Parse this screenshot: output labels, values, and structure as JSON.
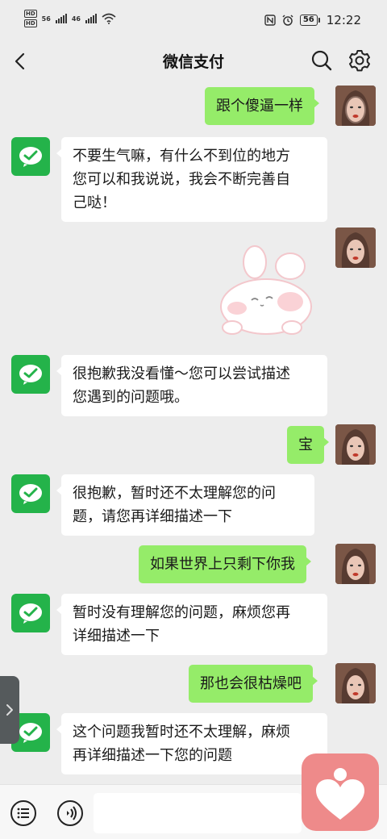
{
  "status_bar": {
    "hd_label": "HD",
    "net_type": "56",
    "net_type_2": "46",
    "battery": "56",
    "time": "12:22"
  },
  "header": {
    "title": "微信支付",
    "icons": [
      "back-arrow",
      "search",
      "settings-gear"
    ]
  },
  "messages": [
    {
      "from": "user",
      "type": "text",
      "text": "跟个傻逼一样"
    },
    {
      "from": "bot",
      "type": "text",
      "lines": [
        "不要生气嘛，有什么不到位的地方",
        "您可以和我说说，我会不断完善自",
        "己哒！"
      ]
    },
    {
      "from": "user",
      "type": "sticker",
      "sticker": "bunny-sticker"
    },
    {
      "from": "bot",
      "type": "text",
      "lines": [
        "很抱歉我没看懂～您可以尝试描述",
        "您遇到的问题哦。"
      ]
    },
    {
      "from": "user",
      "type": "text",
      "text": "宝"
    },
    {
      "from": "bot",
      "type": "text",
      "lines": [
        "很抱歉，暂时还不太理解您的问",
        "题，请您再详细描述一下"
      ]
    },
    {
      "from": "user",
      "type": "text",
      "text": "如果世界上只剩下你我"
    },
    {
      "from": "bot",
      "type": "text",
      "lines": [
        "暂时没有理解您的问题，麻烦您再",
        "详细描述一下"
      ]
    },
    {
      "from": "user",
      "type": "text",
      "text": "那也会很枯燥吧"
    },
    {
      "from": "bot",
      "type": "text",
      "lines": [
        "这个问题我暂时还不太理解，麻烦",
        "再详细描述一下您的问题"
      ]
    }
  ],
  "input": {
    "placeholder": ""
  },
  "colors": {
    "background": "#ededed",
    "user_bubble": "#95ec69",
    "bot_avatar": "#24b34a",
    "heart_widget": "#ee8a8a"
  }
}
